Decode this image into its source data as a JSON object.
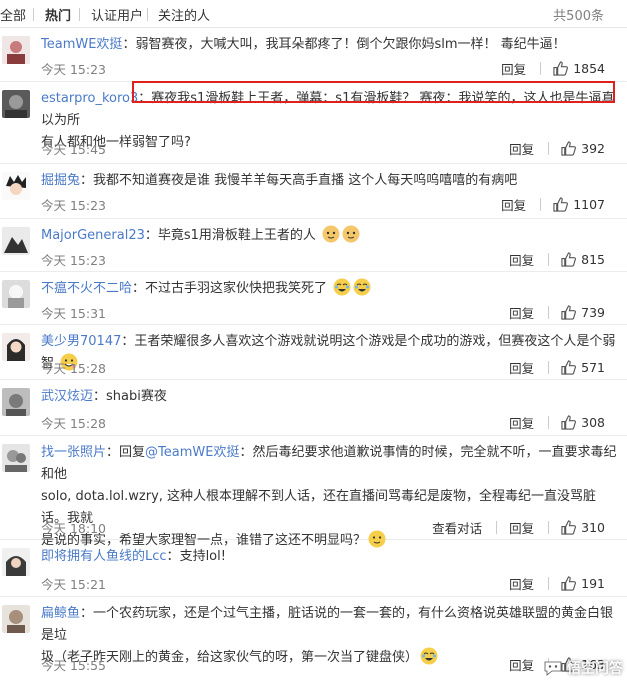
{
  "tabs": [
    "全部",
    "热门",
    "认证用户",
    "关注的人"
  ],
  "total": "共500条",
  "comments": [
    {
      "user": "TeamWE欢挺",
      "user_color": "blue",
      "text": "弱智赛夜，大喊大叫，我耳朵都疼了！倒个欠跟你妈slm一样！ 毒纪牛逼！",
      "time": "今天 15:23",
      "reply": "回复",
      "likes": "1854",
      "avatar_color": "#c8c8c8"
    },
    {
      "user": "estarpro_koro3",
      "user_color": "blue",
      "text_line1": "赛夜我s1滑板鞋上王者，弹幕：s1有滑板鞋？ 赛夜：我说笑的，这人也是牛逼真以为所",
      "text_line2": "有人都和他一样弱智了吗?",
      "time": "今天 15:45",
      "reply": "回复",
      "likes": "392",
      "avatar_color": "#888"
    },
    {
      "user": "掘掘兔",
      "user_color": "blue",
      "text": "我都不知道赛夜是谁 我慢羊羊每天高手直播 这个人每天呜呜嘻嘻的有病吧",
      "time": "今天 15:23",
      "reply": "回复",
      "likes": "1107",
      "avatar_color": "#eee"
    },
    {
      "user": "MajorGeneral23",
      "user_color": "blue",
      "text": "毕竟s1用滑板鞋上王者的人",
      "time": "今天 15:23",
      "reply": "回复",
      "likes": "815",
      "avatar_color": "#ddd"
    },
    {
      "user": "不瘟不火不二哈",
      "user_color": "blue",
      "text": "不过古手羽这家伙快把我笑死了",
      "time": "今天 15:31",
      "reply": "回复",
      "likes": "739",
      "avatar_color": "#bbb"
    },
    {
      "user": "美少男70147",
      "user_color": "blue",
      "text": "王者荣耀很多人喜欢这个游戏就说明这个游戏是个成功的游戏，但赛夜这个人是个弱智",
      "time": "今天 15:28",
      "reply": "回复",
      "likes": "571",
      "avatar_color": "#999"
    },
    {
      "user": "武汉炫迈",
      "user_color": "blue",
      "text": "shabi赛夜",
      "time": "今天 15:28",
      "reply": "回复",
      "likes": "308",
      "avatar_color": "#aaa"
    },
    {
      "user": "找一张照片",
      "user_color": "blue",
      "reply_prefix": "回复",
      "mention": "@TeamWE欢挺",
      "text_line1_rest": "：然后毒纪要求他道歉说事情的时候，完全就不听，一直要求毒纪和他",
      "text_line2": "solo, dota.lol.wzry, 这种人根本理解不到人话，还在直播间骂毒纪是废物，全程毒纪一直没骂脏话。我就",
      "text_line3": "是说的事实，希望大家理智一点，谁错了这还不明显吗？",
      "time": "今天 18:10",
      "view_conversation": "查看对话",
      "reply": "回复",
      "likes": "310",
      "avatar_color": "#bbb"
    },
    {
      "user": "即将拥有人鱼线的Lcc",
      "user_color": "blue",
      "text": "支持lol!",
      "time": "今天 15:21",
      "reply": "回复",
      "likes": "191",
      "avatar_color": "#ccc"
    },
    {
      "user": "扁鲸鱼",
      "user_color": "blue",
      "text_line1": "一个农药玩家，还是个过气主播，脏话说的一套一套的，有什么资格说英雄联盟的黄金白银是垃",
      "text_line2": "圾（老子昨天刚上的黄金，给这家伙气的呀，第一次当了键盘侠）",
      "time": "今天 15:55",
      "reply": "回复",
      "likes": "163",
      "avatar_color": "#ccc"
    }
  ],
  "watermark": "悟空问答",
  "colors": {
    "username": "#4a7ac8",
    "accent_red": "#e0201f",
    "meta": "#808080"
  }
}
